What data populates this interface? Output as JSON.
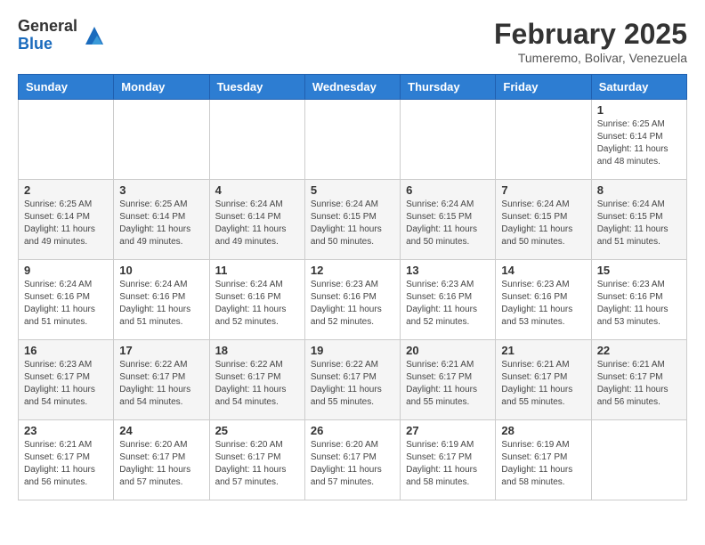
{
  "header": {
    "logo_general": "General",
    "logo_blue": "Blue",
    "month_title": "February 2025",
    "location": "Tumeremo, Bolivar, Venezuela"
  },
  "days_of_week": [
    "Sunday",
    "Monday",
    "Tuesday",
    "Wednesday",
    "Thursday",
    "Friday",
    "Saturday"
  ],
  "weeks": [
    [
      {
        "day": "",
        "info": ""
      },
      {
        "day": "",
        "info": ""
      },
      {
        "day": "",
        "info": ""
      },
      {
        "day": "",
        "info": ""
      },
      {
        "day": "",
        "info": ""
      },
      {
        "day": "",
        "info": ""
      },
      {
        "day": "1",
        "info": "Sunrise: 6:25 AM\nSunset: 6:14 PM\nDaylight: 11 hours\nand 48 minutes."
      }
    ],
    [
      {
        "day": "2",
        "info": "Sunrise: 6:25 AM\nSunset: 6:14 PM\nDaylight: 11 hours\nand 49 minutes."
      },
      {
        "day": "3",
        "info": "Sunrise: 6:25 AM\nSunset: 6:14 PM\nDaylight: 11 hours\nand 49 minutes."
      },
      {
        "day": "4",
        "info": "Sunrise: 6:24 AM\nSunset: 6:14 PM\nDaylight: 11 hours\nand 49 minutes."
      },
      {
        "day": "5",
        "info": "Sunrise: 6:24 AM\nSunset: 6:15 PM\nDaylight: 11 hours\nand 50 minutes."
      },
      {
        "day": "6",
        "info": "Sunrise: 6:24 AM\nSunset: 6:15 PM\nDaylight: 11 hours\nand 50 minutes."
      },
      {
        "day": "7",
        "info": "Sunrise: 6:24 AM\nSunset: 6:15 PM\nDaylight: 11 hours\nand 50 minutes."
      },
      {
        "day": "8",
        "info": "Sunrise: 6:24 AM\nSunset: 6:15 PM\nDaylight: 11 hours\nand 51 minutes."
      }
    ],
    [
      {
        "day": "9",
        "info": "Sunrise: 6:24 AM\nSunset: 6:16 PM\nDaylight: 11 hours\nand 51 minutes."
      },
      {
        "day": "10",
        "info": "Sunrise: 6:24 AM\nSunset: 6:16 PM\nDaylight: 11 hours\nand 51 minutes."
      },
      {
        "day": "11",
        "info": "Sunrise: 6:24 AM\nSunset: 6:16 PM\nDaylight: 11 hours\nand 52 minutes."
      },
      {
        "day": "12",
        "info": "Sunrise: 6:23 AM\nSunset: 6:16 PM\nDaylight: 11 hours\nand 52 minutes."
      },
      {
        "day": "13",
        "info": "Sunrise: 6:23 AM\nSunset: 6:16 PM\nDaylight: 11 hours\nand 52 minutes."
      },
      {
        "day": "14",
        "info": "Sunrise: 6:23 AM\nSunset: 6:16 PM\nDaylight: 11 hours\nand 53 minutes."
      },
      {
        "day": "15",
        "info": "Sunrise: 6:23 AM\nSunset: 6:16 PM\nDaylight: 11 hours\nand 53 minutes."
      }
    ],
    [
      {
        "day": "16",
        "info": "Sunrise: 6:23 AM\nSunset: 6:17 PM\nDaylight: 11 hours\nand 54 minutes."
      },
      {
        "day": "17",
        "info": "Sunrise: 6:22 AM\nSunset: 6:17 PM\nDaylight: 11 hours\nand 54 minutes."
      },
      {
        "day": "18",
        "info": "Sunrise: 6:22 AM\nSunset: 6:17 PM\nDaylight: 11 hours\nand 54 minutes."
      },
      {
        "day": "19",
        "info": "Sunrise: 6:22 AM\nSunset: 6:17 PM\nDaylight: 11 hours\nand 55 minutes."
      },
      {
        "day": "20",
        "info": "Sunrise: 6:21 AM\nSunset: 6:17 PM\nDaylight: 11 hours\nand 55 minutes."
      },
      {
        "day": "21",
        "info": "Sunrise: 6:21 AM\nSunset: 6:17 PM\nDaylight: 11 hours\nand 55 minutes."
      },
      {
        "day": "22",
        "info": "Sunrise: 6:21 AM\nSunset: 6:17 PM\nDaylight: 11 hours\nand 56 minutes."
      }
    ],
    [
      {
        "day": "23",
        "info": "Sunrise: 6:21 AM\nSunset: 6:17 PM\nDaylight: 11 hours\nand 56 minutes."
      },
      {
        "day": "24",
        "info": "Sunrise: 6:20 AM\nSunset: 6:17 PM\nDaylight: 11 hours\nand 57 minutes."
      },
      {
        "day": "25",
        "info": "Sunrise: 6:20 AM\nSunset: 6:17 PM\nDaylight: 11 hours\nand 57 minutes."
      },
      {
        "day": "26",
        "info": "Sunrise: 6:20 AM\nSunset: 6:17 PM\nDaylight: 11 hours\nand 57 minutes."
      },
      {
        "day": "27",
        "info": "Sunrise: 6:19 AM\nSunset: 6:17 PM\nDaylight: 11 hours\nand 58 minutes."
      },
      {
        "day": "28",
        "info": "Sunrise: 6:19 AM\nSunset: 6:17 PM\nDaylight: 11 hours\nand 58 minutes."
      },
      {
        "day": "",
        "info": ""
      }
    ]
  ]
}
